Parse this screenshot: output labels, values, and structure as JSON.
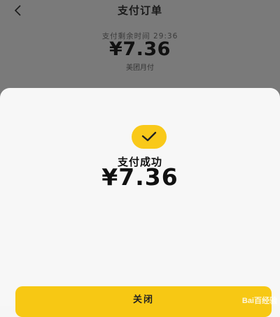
{
  "header": {
    "title": "支付订单",
    "back_icon": "chevron-left-icon"
  },
  "order": {
    "timer_label": "支付剩余时间 29:36",
    "amount": "¥7.36",
    "payment_method": "美团月付"
  },
  "result": {
    "status_icon": "check-icon",
    "status_text": "支付成功",
    "amount": "¥7.36"
  },
  "actions": {
    "close_label": "关闭"
  },
  "watermark": {
    "text": "Bai百经验"
  },
  "colors": {
    "accent": "#f7c814",
    "overlay": "#7a7a7a",
    "sheet": "#f7f7f7"
  }
}
